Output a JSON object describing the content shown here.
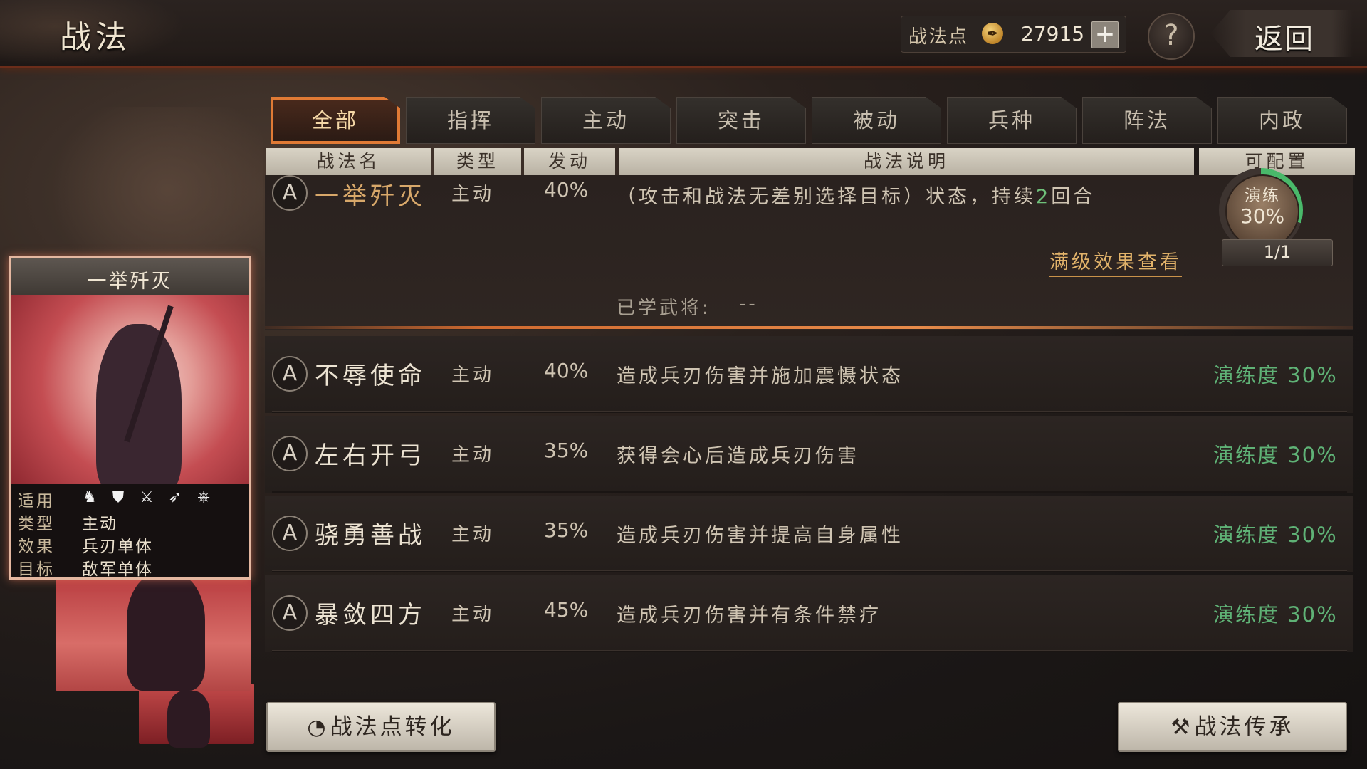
{
  "header": {
    "title": "战法",
    "points_label": "战法点",
    "points_value": "27915",
    "plus_label": "+",
    "help_label": "?",
    "back_label": "返回"
  },
  "tabs": [
    {
      "label": "全部",
      "active": true
    },
    {
      "label": "指挥",
      "active": false
    },
    {
      "label": "主动",
      "active": false
    },
    {
      "label": "突击",
      "active": false
    },
    {
      "label": "被动",
      "active": false
    },
    {
      "label": "兵种",
      "active": false
    },
    {
      "label": "阵法",
      "active": false
    },
    {
      "label": "内政",
      "active": false
    }
  ],
  "columns": {
    "name": "战法名",
    "type": "类型",
    "rate": "发动",
    "desc": "战法说明",
    "config": "可配置"
  },
  "card": {
    "title": "一举歼灭",
    "applicable_label": "适用",
    "type_label": "类型",
    "type_value": "主动",
    "effect_label": "效果",
    "effect_value": "兵刃单体",
    "target_label": "目标",
    "target_value": "敌军单体",
    "troop_icons": [
      "cavalry-icon",
      "shield-icon",
      "crossed-swords-icon",
      "bow-icon",
      "wheel-icon"
    ]
  },
  "expanded": {
    "grade": "A",
    "name": "一举歼灭",
    "type": "主动",
    "rate": "40%",
    "desc_prefix": "（攻击和战法无差别选择目标）状态，持续",
    "desc_highlight": "2",
    "desc_suffix": "回合",
    "full_effect_link": "满级效果查看",
    "learned_label": "已学武将:",
    "learned_value": "--",
    "drill_label": "演练",
    "drill_pct": "30%",
    "drill_progress": 0.3,
    "drill_count": "1/1"
  },
  "rows": [
    {
      "grade": "A",
      "name": "不辱使命",
      "type": "主动",
      "rate": "40%",
      "desc": "造成兵刃伤害并施加震慑状态",
      "progress": "演练度 30%"
    },
    {
      "grade": "A",
      "name": "左右开弓",
      "type": "主动",
      "rate": "35%",
      "desc": "获得会心后造成兵刃伤害",
      "progress": "演练度 30%"
    },
    {
      "grade": "A",
      "name": "骁勇善战",
      "type": "主动",
      "rate": "35%",
      "desc": "造成兵刃伤害并提高自身属性",
      "progress": "演练度 30%"
    },
    {
      "grade": "A",
      "name": "暴敛四方",
      "type": "主动",
      "rate": "45%",
      "desc": "造成兵刃伤害并有条件禁疗",
      "progress": "演练度 30%"
    }
  ],
  "buttons": {
    "convert_icon": "points-icon",
    "convert_label": "战法点转化",
    "inherit_icon": "hammer-icon",
    "inherit_label": "战法传承"
  },
  "colors": {
    "accent_orange": "#e07a35",
    "progress_green": "#5fb276",
    "gold_text": "#e2b36a"
  }
}
